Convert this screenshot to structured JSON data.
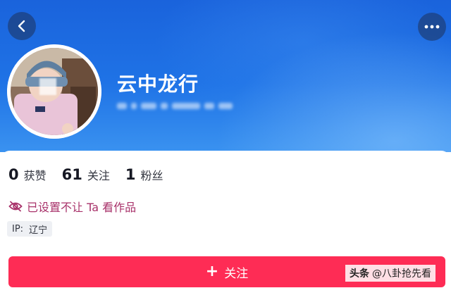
{
  "header": {
    "back_icon": "chevron-left-icon",
    "more_icon": "more-horizontal-icon"
  },
  "profile": {
    "nickname": "云中龙行"
  },
  "stats": [
    {
      "value": "0",
      "label": "获赞"
    },
    {
      "value": "61",
      "label": "关注"
    },
    {
      "value": "1",
      "label": "粉丝"
    }
  ],
  "privacy": {
    "icon": "eye-off-icon",
    "text": "已设置不让 Ta 看作品",
    "color": "#a8326a"
  },
  "ip": {
    "label": "IP:",
    "location": "辽宁"
  },
  "follow_button": {
    "icon": "plus-icon",
    "label": "关注",
    "color": "#fe2c55"
  },
  "watermark": {
    "brand": "头条",
    "handle": "@八卦抢先看"
  },
  "colors": {
    "header_blue": "#1f73e6",
    "text_primary": "#161823"
  }
}
